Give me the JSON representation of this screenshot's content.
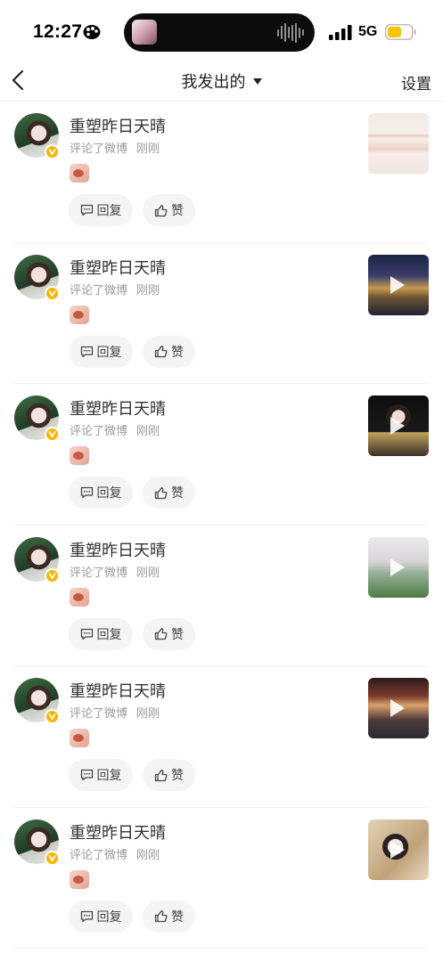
{
  "status_bar": {
    "time": "12:27",
    "network": "5G",
    "battery_color": "#f7c500"
  },
  "header": {
    "title": "我发出的",
    "settings_label": "设置"
  },
  "actions": {
    "reply_label": "回复",
    "like_label": "赞"
  },
  "feed": [
    {
      "user": "重塑昨日天晴",
      "action": "评论了微博",
      "time": "刚刚",
      "thumb": "document",
      "video": false
    },
    {
      "user": "重塑昨日天晴",
      "action": "评论了微博",
      "time": "刚刚",
      "thumb": "night-bridge",
      "video": true
    },
    {
      "user": "重塑昨日天晴",
      "action": "评论了微博",
      "time": "刚刚",
      "thumb": "portrait-dark",
      "video": true
    },
    {
      "user": "重塑昨日天晴",
      "action": "评论了微博",
      "time": "刚刚",
      "thumb": "lying-portrait",
      "video": true
    },
    {
      "user": "重塑昨日天晴",
      "action": "评论了微博",
      "time": "刚刚",
      "thumb": "night-street",
      "video": true
    },
    {
      "user": "重塑昨日天晴",
      "action": "评论了微博",
      "time": "刚刚",
      "thumb": "costume-portrait",
      "video": true
    }
  ],
  "colors": {
    "verified_badge": "#f7b500",
    "pill_bg": "#f4f4f4",
    "meta_text": "#9a9a9a"
  }
}
